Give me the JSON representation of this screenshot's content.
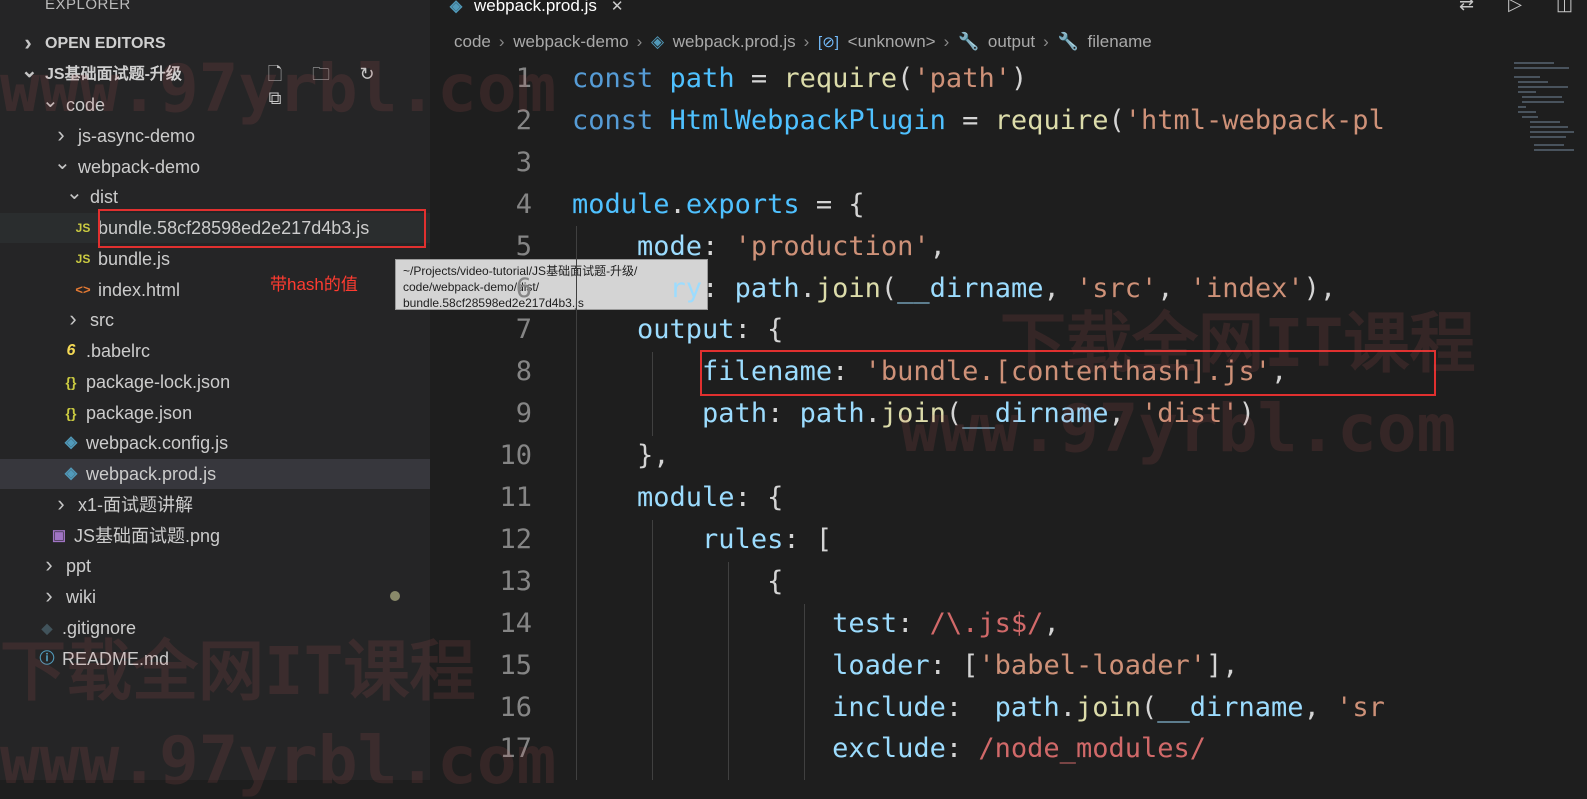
{
  "sidebar": {
    "header": "EXPLORER",
    "sections": {
      "open_editors": "OPEN EDITORS",
      "project": "JS基础面试题-升级"
    },
    "actions": [
      "new-file-icon",
      "new-folder-icon",
      "refresh-icon",
      "collapse-all-icon"
    ],
    "tree": [
      {
        "label": "code",
        "type": "folder",
        "open": true
      },
      {
        "label": "js-async-demo",
        "type": "folder",
        "open": false
      },
      {
        "label": "webpack-demo",
        "type": "folder",
        "open": true
      },
      {
        "label": "dist",
        "type": "folder",
        "open": true
      },
      {
        "label": "bundle.58cf28598ed2e217d4b3.js",
        "type": "js"
      },
      {
        "label": "bundle.js",
        "type": "js"
      },
      {
        "label": "index.html",
        "type": "html"
      },
      {
        "label": "src",
        "type": "folder",
        "open": false
      },
      {
        "label": ".babelrc",
        "type": "babel"
      },
      {
        "label": "package-lock.json",
        "type": "json"
      },
      {
        "label": "package.json",
        "type": "json"
      },
      {
        "label": "webpack.config.js",
        "type": "webpack"
      },
      {
        "label": "webpack.prod.js",
        "type": "webpack",
        "selected": true
      },
      {
        "label": "x1-面试题讲解",
        "type": "folder",
        "open": false
      },
      {
        "label": "JS基础面试题.png",
        "type": "image"
      },
      {
        "label": "ppt",
        "type": "folder",
        "open": false
      },
      {
        "label": "wiki",
        "type": "folder",
        "open": false
      },
      {
        "label": ".gitignore",
        "type": "git"
      },
      {
        "label": "README.md",
        "type": "info"
      }
    ],
    "file_icon_glyphs": {
      "js": "JS",
      "html": "<>",
      "json": "{}",
      "babel": "6",
      "webpack": "◈",
      "image": "▣",
      "git": "◆",
      "info": "ⓘ"
    },
    "annotation": "带hash的值",
    "tooltip": [
      "~/Projects/video-tutorial/JS基础面试题-升级/",
      "code/webpack-demo/dist/",
      "bundle.58cf28598ed2e217d4b3.js"
    ]
  },
  "tab": {
    "label": "webpack.prod.js",
    "close": "✕"
  },
  "breadcrumb": [
    "code",
    "webpack-demo",
    "webpack.prod.js",
    "<unknown>",
    "output",
    "filename"
  ],
  "window_controls": [
    "compare-icon",
    "run-icon",
    "split-editor-icon"
  ],
  "editor": {
    "lines": [
      {
        "n": "1",
        "tokens": [
          [
            "kw",
            "const"
          ],
          [
            "pun",
            " "
          ],
          [
            "var",
            "path"
          ],
          [
            "pun",
            " = "
          ],
          [
            "fn",
            "require"
          ],
          [
            "pun",
            "("
          ],
          [
            "str",
            "'path'"
          ],
          [
            "pun",
            ")"
          ]
        ]
      },
      {
        "n": "2",
        "tokens": [
          [
            "kw",
            "const"
          ],
          [
            "pun",
            " "
          ],
          [
            "var",
            "HtmlWebpackPlugin"
          ],
          [
            "pun",
            " = "
          ],
          [
            "fn",
            "require"
          ],
          [
            "pun",
            "("
          ],
          [
            "str",
            "'html-webpack-pl"
          ]
        ]
      },
      {
        "n": "3",
        "tokens": []
      },
      {
        "n": "4",
        "tokens": [
          [
            "var",
            "module"
          ],
          [
            "pun",
            "."
          ],
          [
            "var",
            "exports"
          ],
          [
            "pun",
            " = {"
          ]
        ]
      },
      {
        "n": "5",
        "tokens": [
          [
            "pun",
            "    "
          ],
          [
            "prop",
            "mode"
          ],
          [
            "pun",
            ": "
          ],
          [
            "str",
            "'production'"
          ],
          [
            "pun",
            ","
          ]
        ]
      },
      {
        "n": "6",
        "tokens": [
          [
            "pun",
            "      "
          ],
          [
            "prop",
            "ry"
          ],
          [
            "pun",
            ": "
          ],
          [
            "prop",
            "path"
          ],
          [
            "pun",
            "."
          ],
          [
            "fn",
            "join"
          ],
          [
            "pun",
            "("
          ],
          [
            "prop",
            "__dirname"
          ],
          [
            "pun",
            ", "
          ],
          [
            "str",
            "'src'"
          ],
          [
            "pun",
            ", "
          ],
          [
            "str",
            "'index'"
          ],
          [
            "pun",
            "),"
          ]
        ]
      },
      {
        "n": "7",
        "tokens": [
          [
            "pun",
            "    "
          ],
          [
            "prop",
            "output"
          ],
          [
            "pun",
            ": {"
          ]
        ]
      },
      {
        "n": "8",
        "tokens": [
          [
            "pun",
            "        "
          ],
          [
            "prop",
            "filename"
          ],
          [
            "pun",
            ": "
          ],
          [
            "str",
            "'bundle.[contenthash].js'"
          ],
          [
            "pun",
            ","
          ]
        ]
      },
      {
        "n": "9",
        "tokens": [
          [
            "pun",
            "        "
          ],
          [
            "prop",
            "path"
          ],
          [
            "pun",
            ": "
          ],
          [
            "prop",
            "path"
          ],
          [
            "pun",
            "."
          ],
          [
            "fn",
            "join"
          ],
          [
            "pun",
            "("
          ],
          [
            "prop",
            "__dirname"
          ],
          [
            "pun",
            ", "
          ],
          [
            "str",
            "'dist'"
          ],
          [
            "pun",
            ")"
          ]
        ]
      },
      {
        "n": "10",
        "tokens": [
          [
            "pun",
            "    },"
          ]
        ]
      },
      {
        "n": "11",
        "tokens": [
          [
            "pun",
            "    "
          ],
          [
            "prop",
            "module"
          ],
          [
            "pun",
            ": {"
          ]
        ]
      },
      {
        "n": "12",
        "tokens": [
          [
            "pun",
            "        "
          ],
          [
            "prop",
            "rules"
          ],
          [
            "pun",
            ": ["
          ]
        ]
      },
      {
        "n": "13",
        "tokens": [
          [
            "pun",
            "            {"
          ]
        ]
      },
      {
        "n": "14",
        "tokens": [
          [
            "pun",
            "                "
          ],
          [
            "prop",
            "test"
          ],
          [
            "pun",
            ": "
          ],
          [
            "re",
            "/\\.js$/"
          ],
          [
            "pun",
            ","
          ]
        ]
      },
      {
        "n": "15",
        "tokens": [
          [
            "pun",
            "                "
          ],
          [
            "prop",
            "loader"
          ],
          [
            "pun",
            ": ["
          ],
          [
            "str",
            "'babel-loader'"
          ],
          [
            "pun",
            "],"
          ]
        ]
      },
      {
        "n": "16",
        "tokens": [
          [
            "pun",
            "                "
          ],
          [
            "prop",
            "include"
          ],
          [
            "pun",
            ":  "
          ],
          [
            "prop",
            "path"
          ],
          [
            "pun",
            "."
          ],
          [
            "fn",
            "join"
          ],
          [
            "pun",
            "("
          ],
          [
            "prop",
            "__dirname"
          ],
          [
            "pun",
            ", "
          ],
          [
            "str",
            "'sr"
          ]
        ]
      },
      {
        "n": "17",
        "tokens": [
          [
            "pun",
            "                "
          ],
          [
            "prop",
            "exclude"
          ],
          [
            "pun",
            ": "
          ],
          [
            "re",
            "/node_modules/"
          ]
        ]
      }
    ]
  },
  "watermark": [
    "www.97yrbl.com",
    "下载全网IT课程"
  ],
  "colors": {
    "highlight_box": "#e1302f",
    "annotation": "#ff3b30"
  }
}
